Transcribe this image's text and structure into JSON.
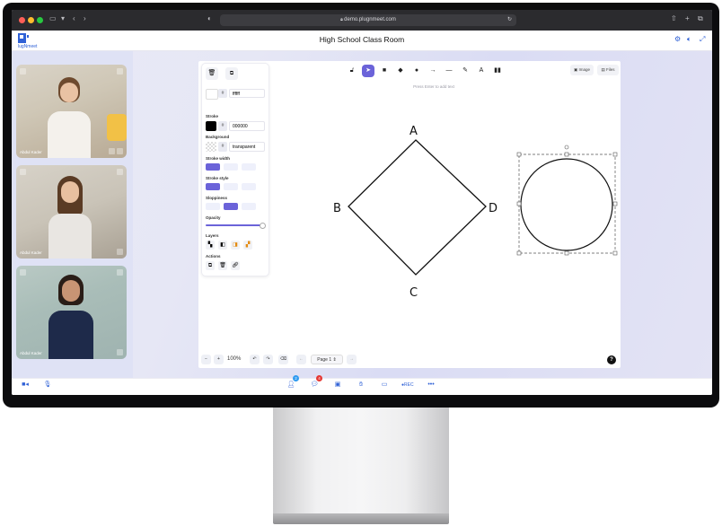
{
  "browser": {
    "address": "demo.plugnmeet.com"
  },
  "app": {
    "title": "High School Class Room",
    "logo_text": "PlugNmeet"
  },
  "participants": [
    {
      "name": "Abdul Kader"
    },
    {
      "name": "Abdul Kader"
    },
    {
      "name": "Abdul Kader"
    }
  ],
  "properties": {
    "fill_value": "ffffff",
    "stroke_label": "Stroke",
    "stroke_value": "000000",
    "background_label": "Background",
    "background_value": "transparent",
    "stroke_width_label": "Stroke width",
    "stroke_style_label": "Stroke style",
    "sloppiness_label": "Sloppiness",
    "opacity_label": "Opacity",
    "layers_label": "Layers",
    "actions_label": "Actions",
    "hash": "#"
  },
  "toolbar": {
    "hint": "Press Enter to add text",
    "image_label": "Image",
    "files_label": "Files",
    "tools": [
      "lock",
      "select",
      "rectangle",
      "diamond",
      "ellipse",
      "arrow",
      "line",
      "draw",
      "text",
      "library"
    ]
  },
  "drawing": {
    "labels": [
      "A",
      "B",
      "C",
      "D"
    ]
  },
  "board_controls": {
    "zoom_out": "−",
    "zoom_in": "+",
    "zoom": "100%",
    "page": "Page 1",
    "help": "?"
  },
  "footer": {
    "participants_badge": "2",
    "chat_badge": "4"
  },
  "colors": {
    "accent": "#6b63d9",
    "brand": "#2f61d6",
    "badge_red": "#e53935",
    "badge_blue": "#2f9bf0"
  }
}
